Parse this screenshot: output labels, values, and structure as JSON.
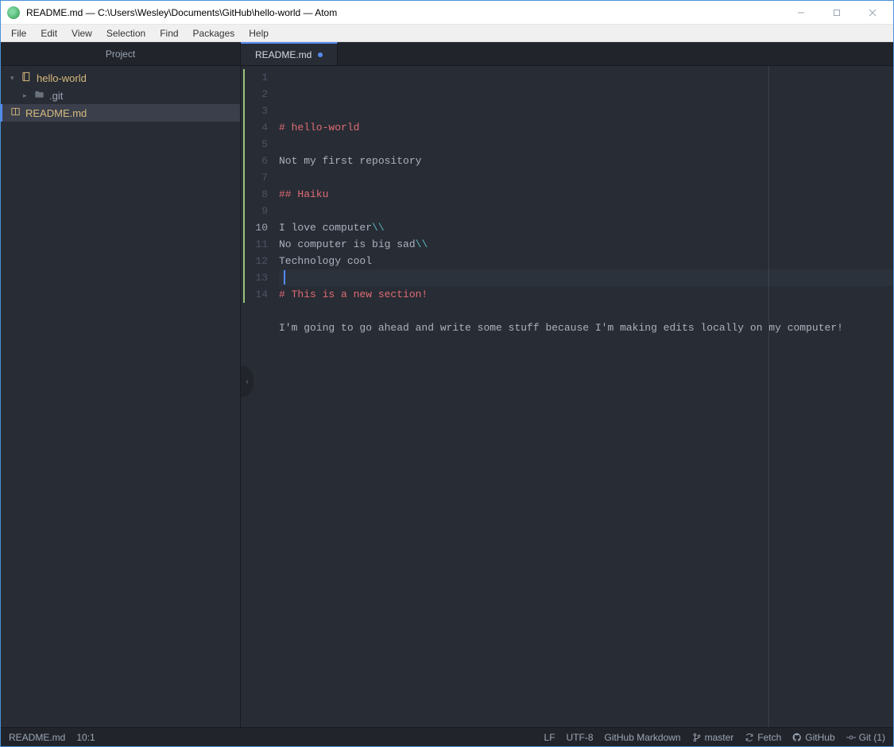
{
  "window": {
    "title": "README.md — C:\\Users\\Wesley\\Documents\\GitHub\\hello-world — Atom"
  },
  "menu": [
    "File",
    "Edit",
    "View",
    "Selection",
    "Find",
    "Packages",
    "Help"
  ],
  "project": {
    "panel_title": "Project",
    "root": "hello-world",
    "items": [
      {
        "label": ".git",
        "type": "folder"
      },
      {
        "label": "README.md",
        "type": "file",
        "selected": true
      }
    ]
  },
  "editor": {
    "tab_label": "README.md",
    "lines": [
      {
        "n": 1,
        "segs": [
          {
            "t": "# hello-world",
            "c": "md-h"
          }
        ]
      },
      {
        "n": 2,
        "segs": []
      },
      {
        "n": 3,
        "segs": [
          {
            "t": "Not my first repository"
          }
        ]
      },
      {
        "n": 4,
        "segs": []
      },
      {
        "n": 5,
        "segs": [
          {
            "t": "## Haiku",
            "c": "md-h"
          }
        ]
      },
      {
        "n": 6,
        "segs": []
      },
      {
        "n": 7,
        "segs": [
          {
            "t": "I love computer"
          },
          {
            "t": "\\\\",
            "c": "md-esc"
          }
        ]
      },
      {
        "n": 8,
        "segs": [
          {
            "t": "No computer is big sad"
          },
          {
            "t": "\\\\",
            "c": "md-esc"
          }
        ]
      },
      {
        "n": 9,
        "segs": [
          {
            "t": "Technology cool"
          }
        ]
      },
      {
        "n": 10,
        "segs": [],
        "cursor": true
      },
      {
        "n": 11,
        "segs": [
          {
            "t": "# This is a new section!",
            "c": "md-h"
          }
        ]
      },
      {
        "n": 12,
        "segs": []
      },
      {
        "n": 13,
        "segs": [
          {
            "t": "I'm going to go ahead and write some stuff because I'm making edits locally on my computer!"
          }
        ]
      },
      {
        "n": 14,
        "segs": []
      }
    ],
    "git_added": {
      "from": 1,
      "to": 14
    }
  },
  "status": {
    "file": "README.md",
    "cursor": "10:1",
    "eol": "LF",
    "encoding": "UTF-8",
    "grammar": "GitHub Markdown",
    "branch": "master",
    "fetch": "Fetch",
    "github": "GitHub",
    "git": "Git (1)"
  }
}
